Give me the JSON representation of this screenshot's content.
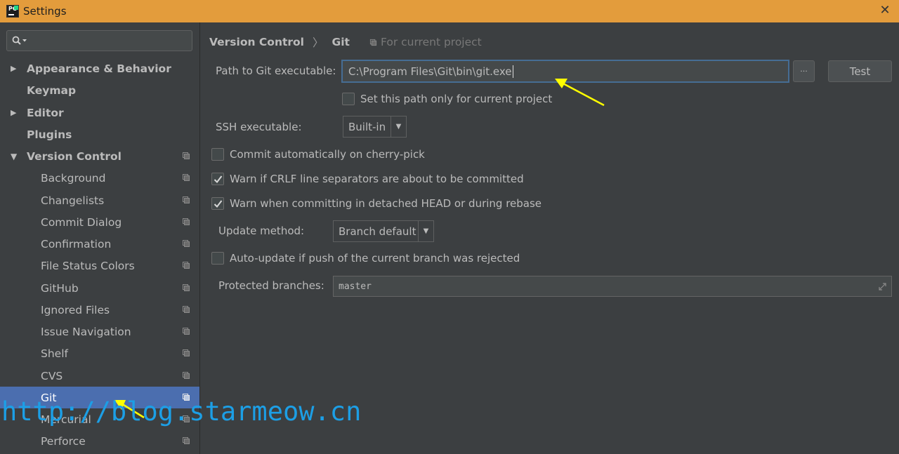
{
  "window": {
    "title": "Settings",
    "close_glyph": "✕"
  },
  "sidebar": {
    "search_placeholder": "",
    "items": [
      {
        "label": "Appearance & Behavior",
        "expandable": true,
        "expanded": false
      },
      {
        "label": "Keymap"
      },
      {
        "label": "Editor",
        "expandable": true,
        "expanded": false
      },
      {
        "label": "Plugins"
      },
      {
        "label": "Version Control",
        "expandable": true,
        "expanded": true
      },
      {
        "label": "Background"
      },
      {
        "label": "Changelists"
      },
      {
        "label": "Commit Dialog"
      },
      {
        "label": "Confirmation"
      },
      {
        "label": "File Status Colors"
      },
      {
        "label": "GitHub"
      },
      {
        "label": "Ignored Files"
      },
      {
        "label": "Issue Navigation"
      },
      {
        "label": "Shelf"
      },
      {
        "label": "CVS"
      },
      {
        "label": "Git",
        "selected": true
      },
      {
        "label": "Mercurial"
      },
      {
        "label": "Perforce"
      }
    ]
  },
  "breadcrumb": {
    "parent": "Version Control",
    "current": "Git",
    "scope": "For current project"
  },
  "form": {
    "git_path_label": "Path to Git executable:",
    "git_path_value": "C:\\Program Files\\Git\\bin\\git.exe",
    "browse_label": "···",
    "test_label": "Test",
    "path_only_label": "Set this path only for current project",
    "ssh_label": "SSH executable:",
    "ssh_value": "Built-in",
    "commit_cherry_label": "Commit automatically on cherry-pick",
    "crlf_label": "Warn if CRLF line separators are about to be committed",
    "detached_label": "Warn when committing in detached HEAD or during rebase",
    "update_method_label": "Update method:",
    "update_method_value": "Branch default",
    "auto_update_label": "Auto-update if push of the current branch was rejected",
    "protected_label": "Protected branches:",
    "protected_value": "master"
  },
  "checkboxes": {
    "path_only": false,
    "commit_cherry": false,
    "crlf": true,
    "detached": true,
    "auto_update": false
  },
  "watermark": "http://blog.starmeow.cn",
  "colors": {
    "titlebar": "#e39c3c",
    "selection": "#4b6eaf",
    "annotation_arrow": "#ffff00",
    "watermark": "#1c9fe6"
  }
}
